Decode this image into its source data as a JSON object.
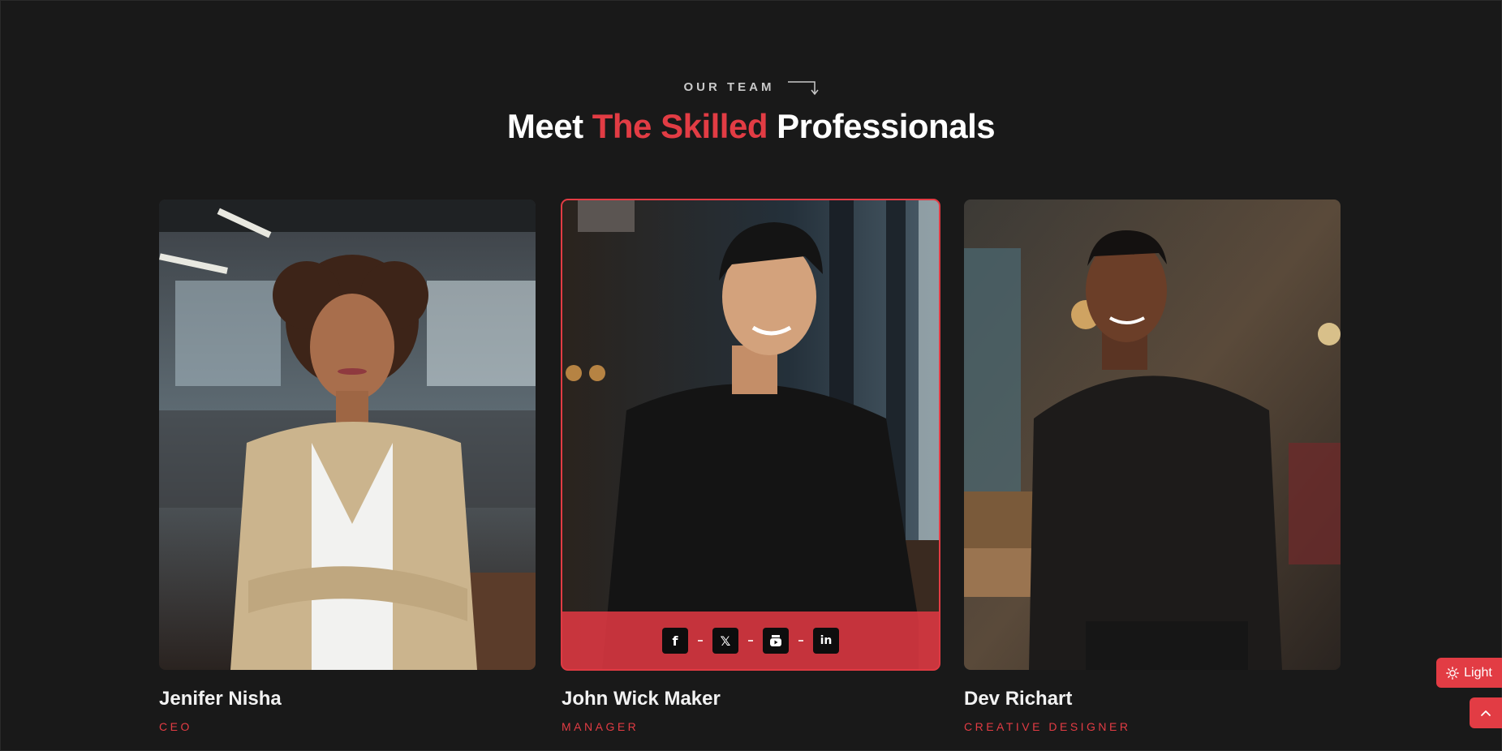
{
  "section": {
    "eyebrow": "OUR TEAM",
    "heading_prefix": "Meet",
    "heading_accent": "The Skilled",
    "heading_suffix": "Professionals"
  },
  "team": [
    {
      "name": "Jenifer Nisha",
      "role": "CEO"
    },
    {
      "name": "John Wick Maker",
      "role": "MANAGER"
    },
    {
      "name": "Dev Richart",
      "role": "CREATIVE DESIGNER"
    }
  ],
  "social": {
    "facebook": "f",
    "twitter": "𝕏",
    "linkedin": "in"
  },
  "theme_toggle": {
    "label": "Light",
    "icon": "sun-icon"
  },
  "colors": {
    "background": "#191919",
    "accent": "#e23c44",
    "text": "#ffffff"
  }
}
